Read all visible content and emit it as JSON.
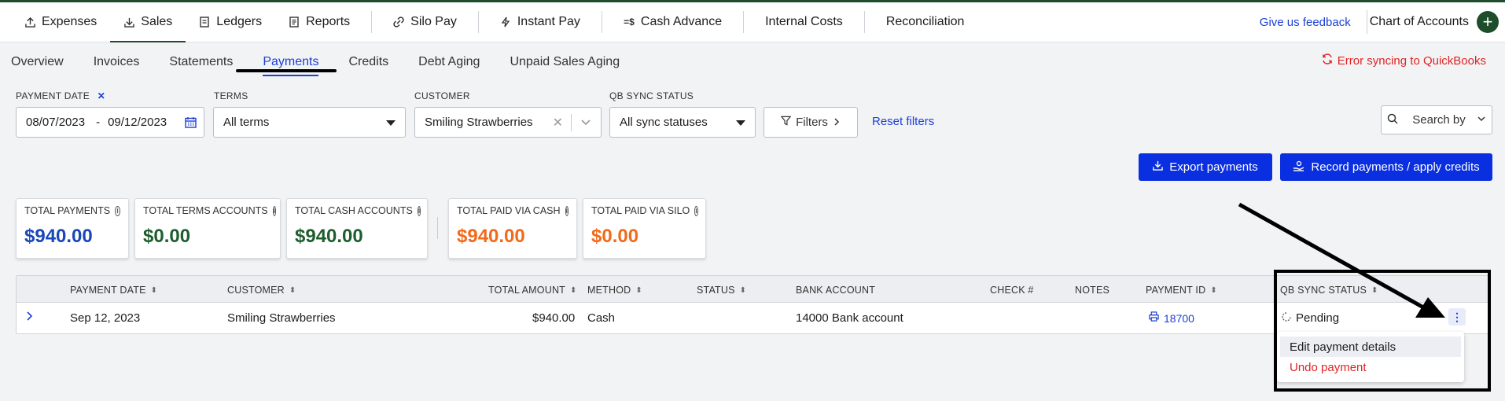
{
  "top_nav": {
    "items": [
      {
        "label": "Expenses",
        "icon": "upload-icon"
      },
      {
        "label": "Sales",
        "icon": "download-icon",
        "active": true
      },
      {
        "label": "Ledgers",
        "icon": "ledger-icon"
      },
      {
        "label": "Reports",
        "icon": "report-icon"
      },
      {
        "label": "Silo Pay",
        "icon": "link-icon"
      },
      {
        "label": "Instant Pay",
        "icon": "bolt-icon"
      },
      {
        "label": "Cash Advance",
        "icon": "cash-icon"
      },
      {
        "label": "Internal Costs"
      },
      {
        "label": "Reconciliation"
      }
    ],
    "feedback": "Give us feedback",
    "chart_of_accounts": "Chart of Accounts",
    "plus": "+"
  },
  "sub_nav": {
    "tabs": [
      "Overview",
      "Invoices",
      "Statements",
      "Payments",
      "Credits",
      "Debt Aging",
      "Unpaid Sales Aging"
    ],
    "active": "Payments",
    "sync_error": "Error syncing to QuickBooks"
  },
  "filters": {
    "payment_date_label": "PAYMENT DATE",
    "date_start": "08/07/2023",
    "date_dash": "-",
    "date_end": "09/12/2023",
    "terms_label": "TERMS",
    "terms_value": "All terms",
    "customer_label": "CUSTOMER",
    "customer_value": "Smiling Strawberries",
    "qb_label": "QB SYNC STATUS",
    "qb_value": "All sync statuses",
    "filters_button": "Filters",
    "reset": "Reset filters",
    "search": "Search by"
  },
  "actions": {
    "export": "Export payments",
    "record": "Record payments / apply credits"
  },
  "summary_cards": [
    {
      "label": "TOTAL PAYMENTS",
      "value": "$940.00",
      "color": "#1a47b8"
    },
    {
      "label": "TOTAL TERMS ACCOUNTS",
      "value": "$0.00",
      "color": "#1e5e2e"
    },
    {
      "label": "TOTAL CASH ACCOUNTS",
      "value": "$940.00",
      "color": "#1e5e2e"
    },
    {
      "label": "TOTAL PAID VIA CASH",
      "value": "$940.00",
      "color": "#f26a1b"
    },
    {
      "label": "TOTAL PAID VIA SILO",
      "value": "$0.00",
      "color": "#f26a1b"
    }
  ],
  "table": {
    "headers": [
      "PAYMENT DATE",
      "CUSTOMER",
      "TOTAL AMOUNT",
      "METHOD",
      "STATUS",
      "BANK ACCOUNT",
      "CHECK #",
      "NOTES",
      "PAYMENT ID",
      "QB SYNC STATUS"
    ],
    "rows": [
      {
        "payment_date": "Sep 12, 2023",
        "customer": "Smiling Strawberries",
        "total_amount": "$940.00",
        "method": "Cash",
        "status": "",
        "bank_account": "14000 Bank account",
        "check": "",
        "notes": "",
        "payment_id": "18700",
        "qb_sync_status": "Pending"
      }
    ]
  },
  "row_menu": {
    "items": [
      "Edit payment details",
      "Undo payment"
    ]
  }
}
